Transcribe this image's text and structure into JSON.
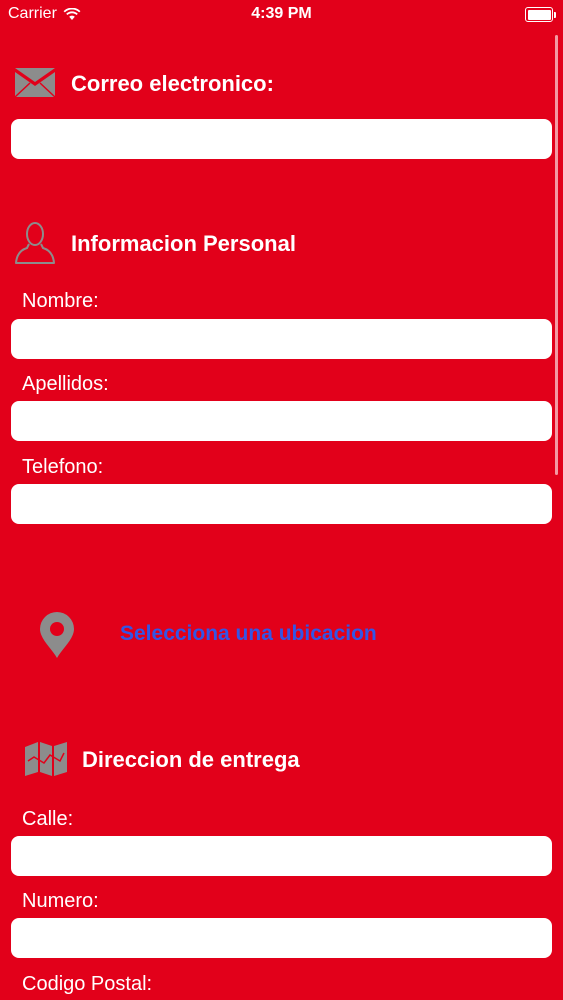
{
  "status_bar": {
    "carrier": "Carrier",
    "time": "4:39 PM"
  },
  "sections": {
    "email": {
      "title": "Correo electronico:",
      "icon": "mail-icon"
    },
    "personal": {
      "title": "Informacion Personal",
      "icon": "user-icon"
    },
    "location": {
      "link": "Selecciona una ubicacion",
      "icon": "location-pin-icon"
    },
    "delivery": {
      "title": "Direccion de entrega",
      "icon": "map-icon"
    }
  },
  "fields": {
    "email": {
      "value": "",
      "placeholder": ""
    },
    "nombre": {
      "label": "Nombre:",
      "value": "",
      "placeholder": ""
    },
    "apellidos": {
      "label": "Apellidos:",
      "value": "",
      "placeholder": ""
    },
    "telefono": {
      "label": "Telefono:",
      "value": "",
      "placeholder": ""
    },
    "calle": {
      "label": "Calle:",
      "value": "",
      "placeholder": ""
    },
    "numero": {
      "label": "Numero:",
      "value": "",
      "placeholder": ""
    },
    "codigo_postal": {
      "label": "Codigo Postal:"
    }
  },
  "colors": {
    "background": "#E2001A",
    "icon_gray": "#8C8C8C",
    "link_blue": "#3355E6",
    "field_bg": "#FFFFFF"
  }
}
